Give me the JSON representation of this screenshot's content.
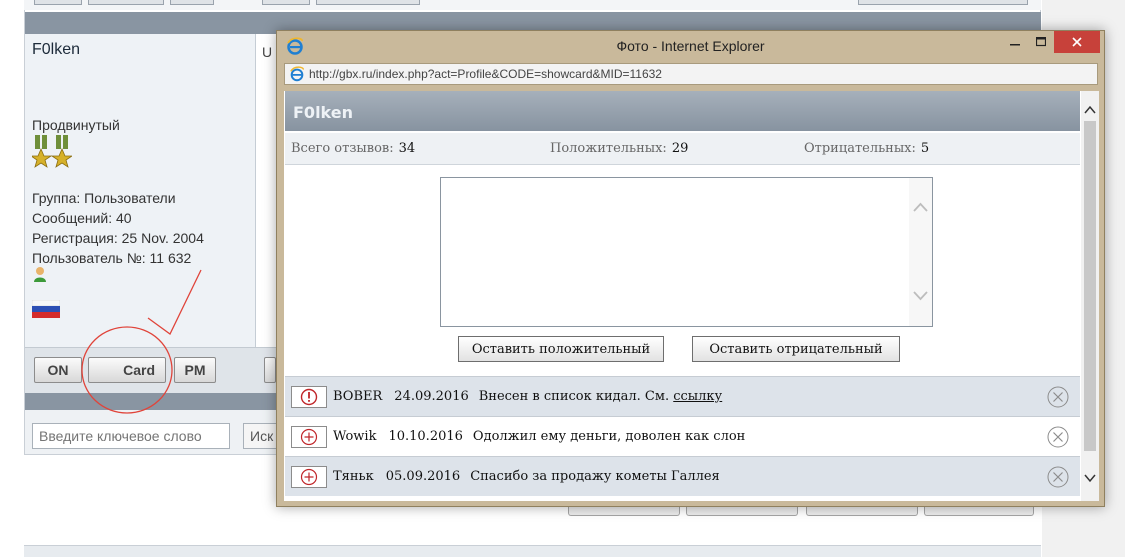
{
  "forum": {
    "username": "F0lken",
    "rank": "Продвинутый",
    "group": "Группа: Пользователи",
    "messages": "Сообщений: 40",
    "registration": "Регистрация: 25 Nov. 2004",
    "user_number": "Пользователь №: 11 632",
    "post_fragment": "U",
    "buttons": {
      "on": "ON",
      "card": "Card",
      "pm": "PM"
    },
    "search_placeholder": "Введите ключевое слово",
    "search_button_fragment": "Иск"
  },
  "popup": {
    "window_title": "Фото - Internet Explorer",
    "url": "http://gbx.ru/index.php?act=Profile&CODE=showcard&MID=11632",
    "card_user": "F0lken",
    "total_label": "Всего отзывов:",
    "total_value": "34",
    "positive_label": "Положительных:",
    "positive_value": "29",
    "negative_label": "Отрицательных:",
    "negative_value": "5",
    "comment_value": "",
    "btn_positive": "Оставить положительный",
    "btn_negative": "Оставить отрицательный",
    "reviews": [
      {
        "type": "negative",
        "author": "BOBER",
        "date": "24.09.2016",
        "text": "Внесен в список кидал. См.",
        "link": "ссылку"
      },
      {
        "type": "positive",
        "author": "Wowik",
        "date": "10.10.2016",
        "text": "Одолжил ему деньги, доволен как слон",
        "link": ""
      },
      {
        "type": "positive",
        "author": "Тяньк",
        "date": "05.09.2016",
        "text": "Спасибо за продажу кометы Галлея",
        "link": ""
      }
    ]
  },
  "colors": {
    "header_band": "#8995a2",
    "close_button": "#c7413a",
    "window_frame": "#c9b99b",
    "annotation": "#e0443a",
    "negative_mark": "#c0262a"
  }
}
